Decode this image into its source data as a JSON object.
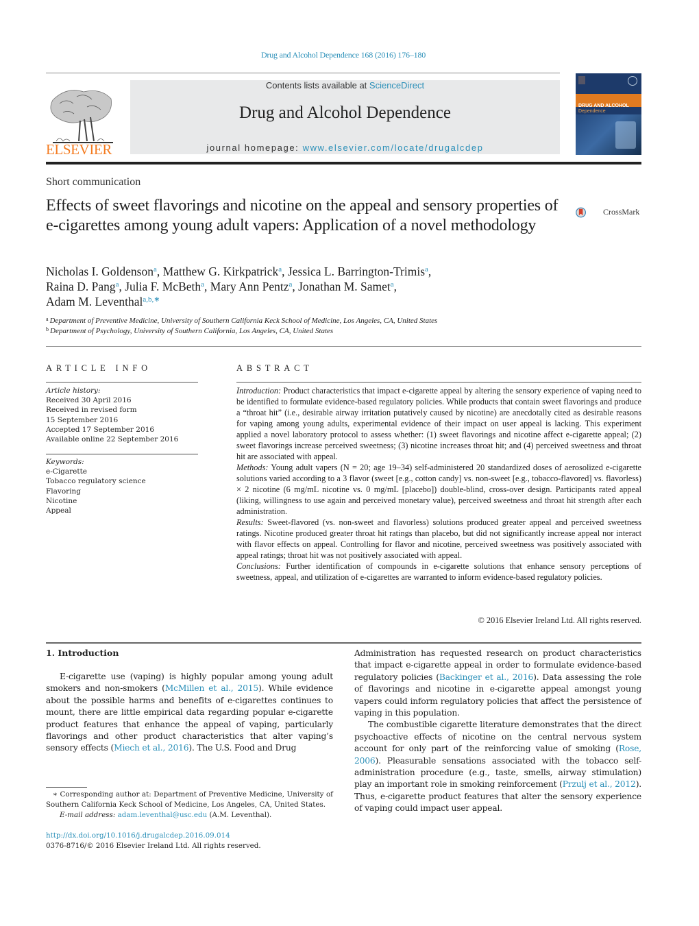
{
  "header": {
    "citation": "Drug and Alcohol Dependence 168 (2016) 176–180",
    "publisher_wordmark": "ELSEVIER",
    "contents_prefix": "Contents lists available at ",
    "contents_link": "ScienceDirect",
    "journal_title": "Drug and Alcohol Dependence",
    "homepage_prefix": "journal homepage: ",
    "homepage_link": "www.elsevier.com/locate/drugalcdep",
    "cover_title": "DRUG AND ALCOHOL",
    "cover_subtitle": "Dependence",
    "accent_color": "#2a8fb8",
    "publisher_color": "#f47b20"
  },
  "article": {
    "type": "Short communication",
    "title": "Effects of sweet flavorings and nicotine on the appeal and sensory properties of e-cigarettes among young adult vapers: Application of a novel methodology",
    "crossmark_label": "CrossMark",
    "authors": [
      {
        "name": "Nicholas I. Goldenson",
        "aff": "a",
        "sep": ", "
      },
      {
        "name": "Matthew G. Kirkpatrick",
        "aff": "a",
        "sep": ", "
      },
      {
        "name": "Jessica L. Barrington-Trimis",
        "aff": "a",
        "sep": ","
      },
      {
        "name": "Raina D. Pang",
        "aff": "a",
        "sep": ", "
      },
      {
        "name": "Julia F. McBeth",
        "aff": "a",
        "sep": ", "
      },
      {
        "name": "Mary Ann Pentz",
        "aff": "a",
        "sep": ", "
      },
      {
        "name": "Jonathan M. Samet",
        "aff": "a",
        "sep": ","
      },
      {
        "name": "Adam M. Leventhal",
        "aff": "a,b,∗",
        "sep": ""
      }
    ],
    "affiliations": [
      {
        "key": "a",
        "text": "Department of Preventive Medicine, University of Southern California Keck School of Medicine, Los Angeles, CA, United States"
      },
      {
        "key": "b",
        "text": "Department of Psychology, University of Southern California, Los Angeles, CA, United States"
      }
    ]
  },
  "article_info": {
    "heading": "ARTICLE INFO",
    "history_label": "Article history:",
    "history": [
      "Received 30 April 2016",
      "Received in revised form",
      "15 September 2016",
      "Accepted 17 September 2016",
      "Available online 22 September 2016"
    ],
    "keywords_label": "Keywords:",
    "keywords": [
      "e-Cigarette",
      "Tobacco regulatory science",
      "Flavoring",
      "Nicotine",
      "Appeal"
    ]
  },
  "abstract": {
    "heading": "ABSTRACT",
    "sections": [
      {
        "label": "Introduction:",
        "text": " Product characteristics that impact e-cigarette appeal by altering the sensory experience of vaping need to be identified to formulate evidence-based regulatory policies. While products that contain sweet flavorings and produce a “throat hit” (i.e., desirable airway irritation putatively caused by nicotine) are anecdotally cited as desirable reasons for vaping among young adults, experimental evidence of their impact on user appeal is lacking. This experiment applied a novel laboratory protocol to assess whether: (1) sweet flavorings and nicotine affect e-cigarette appeal; (2) sweet flavorings increase perceived sweetness; (3) nicotine increases throat hit; and (4) perceived sweetness and throat hit are associated with appeal."
      },
      {
        "label": "Methods:",
        "text": " Young adult vapers (N = 20; age 19–34) self-administered 20 standardized doses of aerosolized e-cigarette solutions varied according to a 3 flavor (sweet [e.g., cotton candy] vs. non-sweet [e.g., tobacco-flavored] vs. flavorless) × 2 nicotine (6 mg/mL nicotine vs. 0 mg/mL [placebo]) double-blind, cross-over design. Participants rated appeal (liking, willingness to use again and perceived monetary value), perceived sweetness and throat hit strength after each administration."
      },
      {
        "label": "Results:",
        "text": " Sweet-flavored (vs. non-sweet and flavorless) solutions produced greater appeal and perceived sweetness ratings. Nicotine produced greater throat hit ratings than placebo, but did not significantly increase appeal nor interact with flavor effects on appeal. Controlling for flavor and nicotine, perceived sweetness was positively associated with appeal ratings; throat hit was not positively associated with appeal."
      },
      {
        "label": "Conclusions:",
        "text": " Further identification of compounds in e-cigarette solutions that enhance sensory perceptions of sweetness, appeal, and utilization of e-cigarettes are warranted to inform evidence-based regulatory policies."
      }
    ],
    "copyright": "© 2016 Elsevier Ireland Ltd. All rights reserved."
  },
  "body": {
    "intro_heading": "1.  Introduction",
    "left_paragraph": [
      {
        "t": "E-cigarette use (vaping) is highly popular among young adult smokers and non-smokers ("
      },
      {
        "link": "McMillen et al., 2015"
      },
      {
        "t": "). While evidence about the possible harms and benefits of e-cigarettes continues to mount, there are little empirical data regarding popular e-cigarette product features that enhance the appeal of vaping, particularly flavorings and other product characteristics that alter vaping’s sensory effects ("
      },
      {
        "link": "Miech et al., 2016"
      },
      {
        "t": "). The U.S. Food and Drug"
      }
    ],
    "right_paragraph_1": [
      {
        "t": "Administration has requested research on product characteristics that impact e-cigarette appeal in order to formulate evidence-based regulatory policies ("
      },
      {
        "link": "Backinger et al., 2016"
      },
      {
        "t": "). Data assessing the role of flavorings and nicotine in e-cigarette appeal amongst young vapers could inform regulatory policies that affect the persistence of vaping in this population."
      }
    ],
    "right_paragraph_2": [
      {
        "t": "The combustible cigarette literature demonstrates that the direct psychoactive effects of nicotine on the central nervous system account for only part of the reinforcing value of smoking ("
      },
      {
        "link": "Rose, 2006"
      },
      {
        "t": "). Pleasurable sensations associated with the tobacco self-administration procedure (e.g., taste, smells, airway stimulation) play an important role in smoking reinforcement ("
      },
      {
        "link": "Przulj et al., 2012"
      },
      {
        "t": "). Thus, e-cigarette product features that alter the sensory experience of vaping could impact user appeal."
      }
    ]
  },
  "footnotes": {
    "corresponding": "∗  Corresponding author at: Department of Preventive Medicine, University of Southern California Keck School of Medicine, Los Angeles, CA, United States.",
    "email_label": "E-mail address:",
    "email": "adam.leventhal@usc.edu",
    "email_suffix": " (A.M. Leventhal).",
    "doi": "http://dx.doi.org/10.1016/j.drugalcdep.2016.09.014",
    "issn_copyright": "0376-8716/© 2016 Elsevier Ireland Ltd. All rights reserved."
  }
}
